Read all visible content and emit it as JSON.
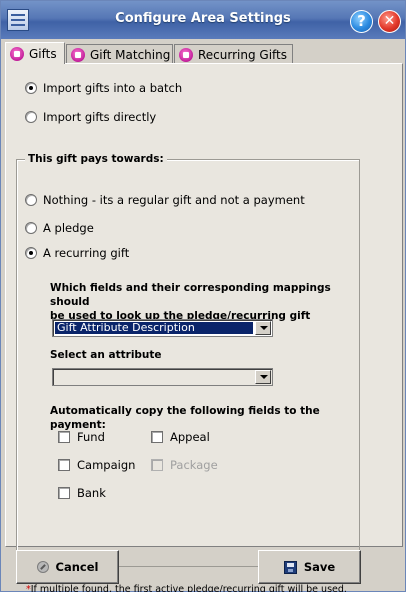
{
  "window": {
    "title": "Configure Area Settings",
    "help_glyph": "?",
    "close_glyph": "✕"
  },
  "tabs": [
    {
      "label": "Gifts",
      "active": true
    },
    {
      "label": "Gift Matching",
      "active": false
    },
    {
      "label": "Recurring Gifts",
      "active": false
    }
  ],
  "import_options": [
    {
      "label": "Import gifts into a batch",
      "selected": true
    },
    {
      "label": "Import gifts directly",
      "selected": false
    }
  ],
  "payment_group": {
    "legend": "This gift pays towards:",
    "options": [
      {
        "label": "Nothing - its a regular gift and not a payment",
        "selected": false
      },
      {
        "label": "A pledge",
        "selected": false
      },
      {
        "label": "A recurring gift",
        "selected": true
      }
    ],
    "lookup_label_line1": "Which fields and their corresponding mappings should",
    "lookup_label_line2": "be used to look up the  pledge/recurring gift",
    "lookup_select_value": "Gift Attribute Description",
    "attribute_label": "Select an attribute",
    "attribute_select_value": "",
    "copy_label": "Automatically copy the following fields to the payment:",
    "copy_fields": [
      {
        "label": "Fund",
        "checked": false,
        "enabled": true
      },
      {
        "label": "Appeal",
        "checked": false,
        "enabled": true
      },
      {
        "label": "Campaign",
        "checked": false,
        "enabled": true
      },
      {
        "label": "Package",
        "checked": false,
        "enabled": false
      },
      {
        "label": "Bank",
        "checked": false,
        "enabled": true
      }
    ]
  },
  "footnote": {
    "star": "*",
    "text": "If multiple found, the first active pledge/recurring gift will be used."
  },
  "buttons": {
    "cancel_label": "Cancel",
    "save_label": "Save"
  },
  "colors": {
    "title_bar": "#4d6fb0",
    "selection": "#0a246a",
    "footnote_star": "#d00000"
  }
}
